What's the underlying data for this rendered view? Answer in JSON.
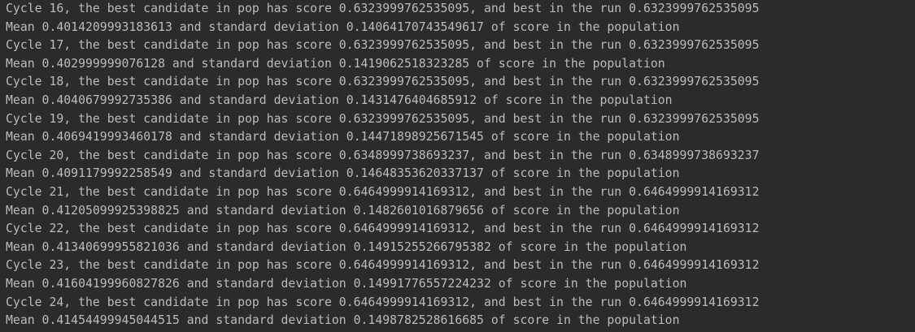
{
  "console": {
    "background_color": "#2b2b2b",
    "text_color": "#bbbbbb",
    "lines": [
      "Cycle 16, the best candidate in pop has score 0.6323999762535095, and best in the run 0.6323999762535095",
      "Mean 0.4014209993183613 and standard deviation 0.14064170743549617 of score in the population",
      "Cycle 17, the best candidate in pop has score 0.6323999762535095, and best in the run 0.6323999762535095",
      "Mean 0.402999999076128 and standard deviation 0.1419062518323285 of score in the population",
      "Cycle 18, the best candidate in pop has score 0.6323999762535095, and best in the run 0.6323999762535095",
      "Mean 0.4040679992735386 and standard deviation 0.1431476404685912 of score in the population",
      "Cycle 19, the best candidate in pop has score 0.6323999762535095, and best in the run 0.6323999762535095",
      "Mean 0.4069419993460178 and standard deviation 0.14471898925671545 of score in the population",
      "Cycle 20, the best candidate in pop has score 0.6348999738693237, and best in the run 0.6348999738693237",
      "Mean 0.4091179992258549 and standard deviation 0.14648353620337137 of score in the population",
      "Cycle 21, the best candidate in pop has score 0.6464999914169312, and best in the run 0.6464999914169312",
      "Mean 0.41205099925398825 and standard deviation 0.1482601016879656 of score in the population",
      "Cycle 22, the best candidate in pop has score 0.6464999914169312, and best in the run 0.6464999914169312",
      "Mean 0.41340699955821036 and standard deviation 0.14915255266795382 of score in the population",
      "Cycle 23, the best candidate in pop has score 0.6464999914169312, and best in the run 0.6464999914169312",
      "Mean 0.41604199960827826 and standard deviation 0.14991776557224232 of score in the population",
      "Cycle 24, the best candidate in pop has score 0.6464999914169312, and best in the run 0.6464999914169312",
      "Mean 0.41454499945044515 and standard deviation 0.1498782528616685 of score in the population"
    ]
  }
}
